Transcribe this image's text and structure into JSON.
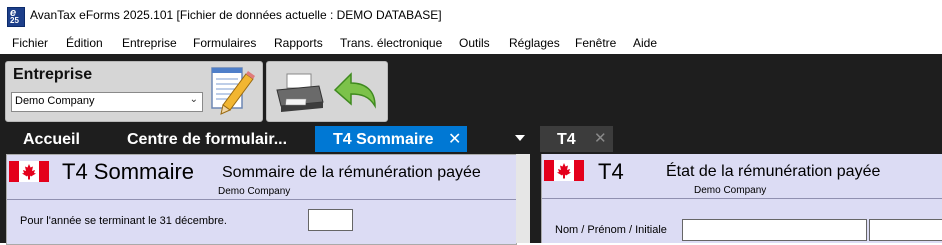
{
  "window": {
    "title": "AvanTax eForms 2025.101 [Fichier de données actuelle : DEMO DATABASE]",
    "icon_top": "e",
    "icon_bottom": "25"
  },
  "menu": [
    "Fichier",
    "Édition",
    "Entreprise",
    "Formulaires",
    "Rapports",
    "Trans. électronique",
    "Outils",
    "Réglages",
    "Fenêtre",
    "Aide"
  ],
  "toolbar": {
    "entreprise_label": "Entreprise",
    "company_selected": "Demo Company",
    "icons": [
      "notepad-pencil-icon",
      "printer-icon",
      "back-arrow-icon"
    ]
  },
  "tabs_left": [
    {
      "label": "Accueil",
      "active": false
    },
    {
      "label": "Centre de formulair...",
      "active": false
    },
    {
      "label": "T4 Sommaire",
      "active": true,
      "close": "✕"
    }
  ],
  "tabs_right": [
    {
      "label": "T4",
      "close": "✕"
    }
  ],
  "form_left": {
    "code": "T4 Sommaire",
    "description": "Sommaire de la rémunération payée",
    "company": "Demo Company",
    "year_label": "Pour l'année se terminant le 31 décembre.",
    "year_value": ""
  },
  "form_right": {
    "code": "T4",
    "description": "État de la rémunération payée",
    "company": "Demo Company",
    "name_label": "Nom / Prénom / Initiale",
    "name_value": "",
    "name_value2": ""
  },
  "colors": {
    "active_tab": "#0078d4",
    "form_bg": "#dcdcf4",
    "dark_bg": "#1e1e1e",
    "flag_red": "#e4001b"
  }
}
